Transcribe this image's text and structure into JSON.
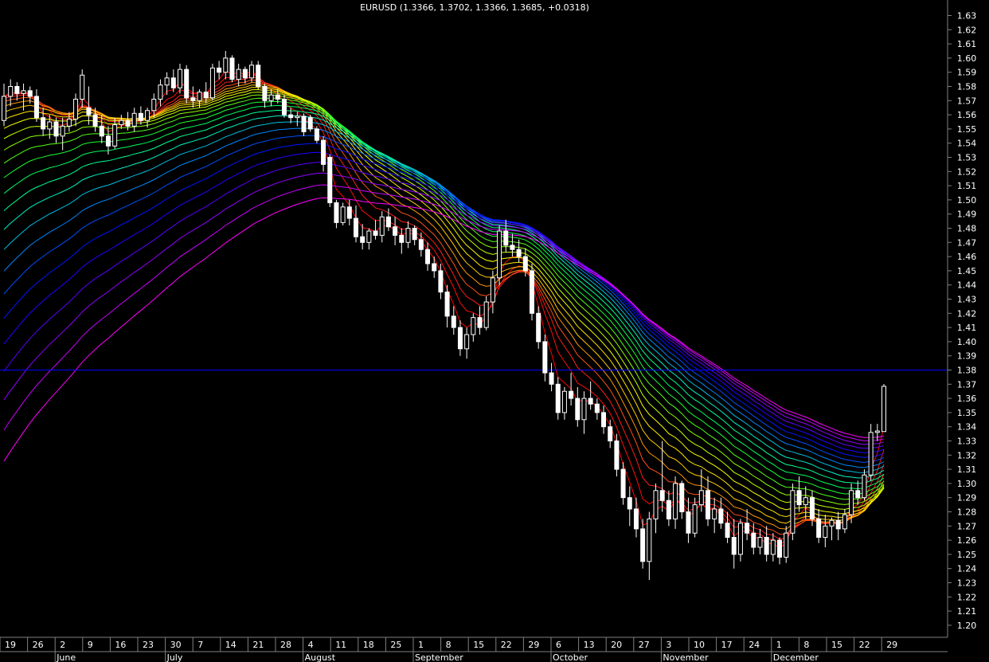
{
  "chart_data": {
    "type": "candlestick",
    "title": "EURUSD (1.3366, 1.3702, 1.3366, 1.3685, +0.0318)",
    "price_line": 1.38,
    "ylim": [
      1.195,
      1.645
    ],
    "y_ticks": [
      "1.63",
      "1.62",
      "1.61",
      "1.60",
      "1.59",
      "1.58",
      "1.57",
      "1.56",
      "1.55",
      "1.54",
      "1.53",
      "1.52",
      "1.51",
      "1.50",
      "1.49",
      "1.48",
      "1.47",
      "1.46",
      "1.45",
      "1.44",
      "1.43",
      "1.42",
      "1.41",
      "1.40",
      "1.39",
      "1.38",
      "1.37",
      "1.36",
      "1.35",
      "1.34",
      "1.33",
      "1.32",
      "1.31",
      "1.30",
      "1.29",
      "1.28",
      "1.27",
      "1.26",
      "1.25",
      "1.24",
      "1.23",
      "1.22",
      "1.21",
      "1.20"
    ],
    "x_day_ticks": [
      "19",
      "26",
      "2",
      "9",
      "16",
      "23",
      "30",
      "7",
      "14",
      "21",
      "28",
      "4",
      "11",
      "18",
      "25",
      "1",
      "8",
      "15",
      "22",
      "29",
      "6",
      "13",
      "20",
      "27",
      "3",
      "10",
      "17",
      "24",
      "1",
      "8",
      "15",
      "22",
      "29"
    ],
    "x_month_labels": [
      "June",
      "July",
      "August",
      "September",
      "October",
      "November",
      "December"
    ],
    "candles": [
      {
        "o": 1.556,
        "h": 1.582,
        "l": 1.552,
        "c": 1.573
      },
      {
        "o": 1.573,
        "h": 1.585,
        "l": 1.566,
        "c": 1.58
      },
      {
        "o": 1.58,
        "h": 1.583,
        "l": 1.57,
        "c": 1.575
      },
      {
        "o": 1.575,
        "h": 1.582,
        "l": 1.563,
        "c": 1.577
      },
      {
        "o": 1.577,
        "h": 1.58,
        "l": 1.568,
        "c": 1.573
      },
      {
        "o": 1.573,
        "h": 1.578,
        "l": 1.555,
        "c": 1.558
      },
      {
        "o": 1.558,
        "h": 1.565,
        "l": 1.545,
        "c": 1.55
      },
      {
        "o": 1.55,
        "h": 1.56,
        "l": 1.543,
        "c": 1.555
      },
      {
        "o": 1.555,
        "h": 1.558,
        "l": 1.54,
        "c": 1.545
      },
      {
        "o": 1.545,
        "h": 1.558,
        "l": 1.535,
        "c": 1.552
      },
      {
        "o": 1.552,
        "h": 1.562,
        "l": 1.548,
        "c": 1.557
      },
      {
        "o": 1.557,
        "h": 1.575,
        "l": 1.552,
        "c": 1.571
      },
      {
        "o": 1.571,
        "h": 1.592,
        "l": 1.565,
        "c": 1.588
      },
      {
        "o": 1.565,
        "h": 1.58,
        "l": 1.553,
        "c": 1.56
      },
      {
        "o": 1.56,
        "h": 1.565,
        "l": 1.548,
        "c": 1.552
      },
      {
        "o": 1.552,
        "h": 1.56,
        "l": 1.54,
        "c": 1.545
      },
      {
        "o": 1.545,
        "h": 1.552,
        "l": 1.532,
        "c": 1.538
      },
      {
        "o": 1.538,
        "h": 1.558,
        "l": 1.536,
        "c": 1.553
      },
      {
        "o": 1.553,
        "h": 1.56,
        "l": 1.55,
        "c": 1.556
      },
      {
        "o": 1.556,
        "h": 1.562,
        "l": 1.549,
        "c": 1.552
      },
      {
        "o": 1.552,
        "h": 1.565,
        "l": 1.548,
        "c": 1.561
      },
      {
        "o": 1.561,
        "h": 1.566,
        "l": 1.553,
        "c": 1.556
      },
      {
        "o": 1.556,
        "h": 1.565,
        "l": 1.551,
        "c": 1.563
      },
      {
        "o": 1.563,
        "h": 1.575,
        "l": 1.558,
        "c": 1.571
      },
      {
        "o": 1.571,
        "h": 1.585,
        "l": 1.566,
        "c": 1.581
      },
      {
        "o": 1.581,
        "h": 1.59,
        "l": 1.574,
        "c": 1.586
      },
      {
        "o": 1.586,
        "h": 1.592,
        "l": 1.576,
        "c": 1.579
      },
      {
        "o": 1.579,
        "h": 1.596,
        "l": 1.575,
        "c": 1.592
      },
      {
        "o": 1.592,
        "h": 1.595,
        "l": 1.568,
        "c": 1.572
      },
      {
        "o": 1.572,
        "h": 1.58,
        "l": 1.565,
        "c": 1.57
      },
      {
        "o": 1.57,
        "h": 1.578,
        "l": 1.565,
        "c": 1.576
      },
      {
        "o": 1.576,
        "h": 1.583,
        "l": 1.568,
        "c": 1.572
      },
      {
        "o": 1.572,
        "h": 1.596,
        "l": 1.57,
        "c": 1.593
      },
      {
        "o": 1.593,
        "h": 1.598,
        "l": 1.585,
        "c": 1.59
      },
      {
        "o": 1.59,
        "h": 1.605,
        "l": 1.585,
        "c": 1.6
      },
      {
        "o": 1.6,
        "h": 1.602,
        "l": 1.583,
        "c": 1.585
      },
      {
        "o": 1.585,
        "h": 1.596,
        "l": 1.58,
        "c": 1.592
      },
      {
        "o": 1.592,
        "h": 1.594,
        "l": 1.582,
        "c": 1.586
      },
      {
        "o": 1.586,
        "h": 1.598,
        "l": 1.583,
        "c": 1.595
      },
      {
        "o": 1.595,
        "h": 1.598,
        "l": 1.578,
        "c": 1.58
      },
      {
        "o": 1.58,
        "h": 1.582,
        "l": 1.565,
        "c": 1.57
      },
      {
        "o": 1.57,
        "h": 1.578,
        "l": 1.566,
        "c": 1.574
      },
      {
        "o": 1.574,
        "h": 1.578,
        "l": 1.568,
        "c": 1.571
      },
      {
        "o": 1.571,
        "h": 1.574,
        "l": 1.558,
        "c": 1.56
      },
      {
        "o": 1.56,
        "h": 1.565,
        "l": 1.554,
        "c": 1.558
      },
      {
        "o": 1.558,
        "h": 1.562,
        "l": 1.552,
        "c": 1.559
      },
      {
        "o": 1.559,
        "h": 1.561,
        "l": 1.545,
        "c": 1.548
      },
      {
        "o": 1.558,
        "h": 1.56,
        "l": 1.548,
        "c": 1.55
      },
      {
        "o": 1.55,
        "h": 1.552,
        "l": 1.54,
        "c": 1.542
      },
      {
        "o": 1.542,
        "h": 1.545,
        "l": 1.52,
        "c": 1.525
      },
      {
        "o": 1.53,
        "h": 1.532,
        "l": 1.495,
        "c": 1.498
      },
      {
        "o": 1.498,
        "h": 1.5,
        "l": 1.48,
        "c": 1.484
      },
      {
        "o": 1.484,
        "h": 1.498,
        "l": 1.482,
        "c": 1.495
      },
      {
        "o": 1.495,
        "h": 1.5,
        "l": 1.482,
        "c": 1.487
      },
      {
        "o": 1.487,
        "h": 1.496,
        "l": 1.47,
        "c": 1.474
      },
      {
        "o": 1.474,
        "h": 1.483,
        "l": 1.465,
        "c": 1.47
      },
      {
        "o": 1.47,
        "h": 1.48,
        "l": 1.465,
        "c": 1.478
      },
      {
        "o": 1.478,
        "h": 1.486,
        "l": 1.472,
        "c": 1.475
      },
      {
        "o": 1.475,
        "h": 1.492,
        "l": 1.47,
        "c": 1.488
      },
      {
        "o": 1.488,
        "h": 1.494,
        "l": 1.478,
        "c": 1.481
      },
      {
        "o": 1.481,
        "h": 1.488,
        "l": 1.468,
        "c": 1.475
      },
      {
        "o": 1.475,
        "h": 1.48,
        "l": 1.462,
        "c": 1.47
      },
      {
        "o": 1.47,
        "h": 1.485,
        "l": 1.466,
        "c": 1.48
      },
      {
        "o": 1.48,
        "h": 1.482,
        "l": 1.468,
        "c": 1.472
      },
      {
        "o": 1.472,
        "h": 1.477,
        "l": 1.46,
        "c": 1.465
      },
      {
        "o": 1.465,
        "h": 1.47,
        "l": 1.45,
        "c": 1.455
      },
      {
        "o": 1.455,
        "h": 1.46,
        "l": 1.445,
        "c": 1.45
      },
      {
        "o": 1.45,
        "h": 1.455,
        "l": 1.43,
        "c": 1.435
      },
      {
        "o": 1.435,
        "h": 1.44,
        "l": 1.41,
        "c": 1.418
      },
      {
        "o": 1.418,
        "h": 1.425,
        "l": 1.405,
        "c": 1.41
      },
      {
        "o": 1.41,
        "h": 1.415,
        "l": 1.39,
        "c": 1.395
      },
      {
        "o": 1.395,
        "h": 1.41,
        "l": 1.388,
        "c": 1.405
      },
      {
        "o": 1.405,
        "h": 1.42,
        "l": 1.4,
        "c": 1.417
      },
      {
        "o": 1.417,
        "h": 1.425,
        "l": 1.405,
        "c": 1.41
      },
      {
        "o": 1.41,
        "h": 1.432,
        "l": 1.408,
        "c": 1.428
      },
      {
        "o": 1.428,
        "h": 1.45,
        "l": 1.42,
        "c": 1.445
      },
      {
        "o": 1.445,
        "h": 1.482,
        "l": 1.44,
        "c": 1.478
      },
      {
        "o": 1.478,
        "h": 1.486,
        "l": 1.463,
        "c": 1.468
      },
      {
        "o": 1.468,
        "h": 1.476,
        "l": 1.46,
        "c": 1.465
      },
      {
        "o": 1.465,
        "h": 1.472,
        "l": 1.456,
        "c": 1.46
      },
      {
        "o": 1.46,
        "h": 1.466,
        "l": 1.446,
        "c": 1.45
      },
      {
        "o": 1.45,
        "h": 1.455,
        "l": 1.415,
        "c": 1.42
      },
      {
        "o": 1.42,
        "h": 1.425,
        "l": 1.395,
        "c": 1.4
      },
      {
        "o": 1.4,
        "h": 1.405,
        "l": 1.372,
        "c": 1.378
      },
      {
        "o": 1.378,
        "h": 1.385,
        "l": 1.365,
        "c": 1.37
      },
      {
        "o": 1.37,
        "h": 1.375,
        "l": 1.345,
        "c": 1.35
      },
      {
        "o": 1.35,
        "h": 1.368,
        "l": 1.345,
        "c": 1.365
      },
      {
        "o": 1.365,
        "h": 1.378,
        "l": 1.355,
        "c": 1.36
      },
      {
        "o": 1.36,
        "h": 1.368,
        "l": 1.34,
        "c": 1.345
      },
      {
        "o": 1.345,
        "h": 1.365,
        "l": 1.335,
        "c": 1.36
      },
      {
        "o": 1.36,
        "h": 1.372,
        "l": 1.352,
        "c": 1.356
      },
      {
        "o": 1.356,
        "h": 1.36,
        "l": 1.345,
        "c": 1.35
      },
      {
        "o": 1.35,
        "h": 1.355,
        "l": 1.335,
        "c": 1.34
      },
      {
        "o": 1.34,
        "h": 1.345,
        "l": 1.325,
        "c": 1.33
      },
      {
        "o": 1.33,
        "h": 1.335,
        "l": 1.305,
        "c": 1.31
      },
      {
        "o": 1.31,
        "h": 1.315,
        "l": 1.285,
        "c": 1.29
      },
      {
        "o": 1.29,
        "h": 1.298,
        "l": 1.27,
        "c": 1.282
      },
      {
        "o": 1.282,
        "h": 1.29,
        "l": 1.262,
        "c": 1.268
      },
      {
        "o": 1.268,
        "h": 1.275,
        "l": 1.24,
        "c": 1.245
      },
      {
        "o": 1.245,
        "h": 1.28,
        "l": 1.232,
        "c": 1.275
      },
      {
        "o": 1.275,
        "h": 1.3,
        "l": 1.265,
        "c": 1.295
      },
      {
        "o": 1.295,
        "h": 1.33,
        "l": 1.28,
        "c": 1.288
      },
      {
        "o": 1.288,
        "h": 1.295,
        "l": 1.27,
        "c": 1.275
      },
      {
        "o": 1.275,
        "h": 1.305,
        "l": 1.268,
        "c": 1.3
      },
      {
        "o": 1.3,
        "h": 1.302,
        "l": 1.275,
        "c": 1.28
      },
      {
        "o": 1.28,
        "h": 1.29,
        "l": 1.258,
        "c": 1.265
      },
      {
        "o": 1.265,
        "h": 1.29,
        "l": 1.262,
        "c": 1.285
      },
      {
        "o": 1.285,
        "h": 1.31,
        "l": 1.28,
        "c": 1.295
      },
      {
        "o": 1.295,
        "h": 1.305,
        "l": 1.27,
        "c": 1.275
      },
      {
        "o": 1.275,
        "h": 1.29,
        "l": 1.265,
        "c": 1.282
      },
      {
        "o": 1.282,
        "h": 1.29,
        "l": 1.268,
        "c": 1.272
      },
      {
        "o": 1.272,
        "h": 1.28,
        "l": 1.258,
        "c": 1.262
      },
      {
        "o": 1.262,
        "h": 1.275,
        "l": 1.24,
        "c": 1.25
      },
      {
        "o": 1.25,
        "h": 1.275,
        "l": 1.245,
        "c": 1.272
      },
      {
        "o": 1.272,
        "h": 1.282,
        "l": 1.26,
        "c": 1.265
      },
      {
        "o": 1.265,
        "h": 1.272,
        "l": 1.25,
        "c": 1.255
      },
      {
        "o": 1.255,
        "h": 1.268,
        "l": 1.25,
        "c": 1.262
      },
      {
        "o": 1.262,
        "h": 1.27,
        "l": 1.245,
        "c": 1.25
      },
      {
        "o": 1.25,
        "h": 1.265,
        "l": 1.245,
        "c": 1.26
      },
      {
        "o": 1.26,
        "h": 1.262,
        "l": 1.243,
        "c": 1.248
      },
      {
        "o": 1.248,
        "h": 1.27,
        "l": 1.244,
        "c": 1.265
      },
      {
        "o": 1.265,
        "h": 1.3,
        "l": 1.26,
        "c": 1.295
      },
      {
        "o": 1.295,
        "h": 1.305,
        "l": 1.28,
        "c": 1.285
      },
      {
        "o": 1.285,
        "h": 1.298,
        "l": 1.275,
        "c": 1.29
      },
      {
        "o": 1.29,
        "h": 1.295,
        "l": 1.27,
        "c": 1.275
      },
      {
        "o": 1.275,
        "h": 1.282,
        "l": 1.258,
        "c": 1.262
      },
      {
        "o": 1.262,
        "h": 1.278,
        "l": 1.255,
        "c": 1.27
      },
      {
        "o": 1.27,
        "h": 1.276,
        "l": 1.26,
        "c": 1.274
      },
      {
        "o": 1.274,
        "h": 1.28,
        "l": 1.26,
        "c": 1.268
      },
      {
        "o": 1.268,
        "h": 1.282,
        "l": 1.265,
        "c": 1.278
      },
      {
        "o": 1.278,
        "h": 1.3,
        "l": 1.272,
        "c": 1.295
      },
      {
        "o": 1.295,
        "h": 1.302,
        "l": 1.285,
        "c": 1.29
      },
      {
        "o": 1.29,
        "h": 1.31,
        "l": 1.288,
        "c": 1.306
      },
      {
        "o": 1.306,
        "h": 1.342,
        "l": 1.302,
        "c": 1.336
      },
      {
        "o": 1.336,
        "h": 1.342,
        "l": 1.33,
        "c": 1.337
      },
      {
        "o": 1.3366,
        "h": 1.3702,
        "l": 1.3366,
        "c": 1.3685
      }
    ],
    "ribbon": {
      "line_count": 24,
      "inner_colors": [
        "#ff0000",
        "#ff2020",
        "#ffc000",
        "#ffff00",
        "#80ff00",
        "#00ff40",
        "#00ffc0",
        "#0080ff",
        "#0000ff",
        "#8000ff",
        "#ff00ff"
      ]
    },
    "colors": {
      "background": "#000000",
      "candle": "#ffffff",
      "price_line": "#0000ff",
      "axis": "#808080",
      "text": "#ffffff"
    }
  }
}
